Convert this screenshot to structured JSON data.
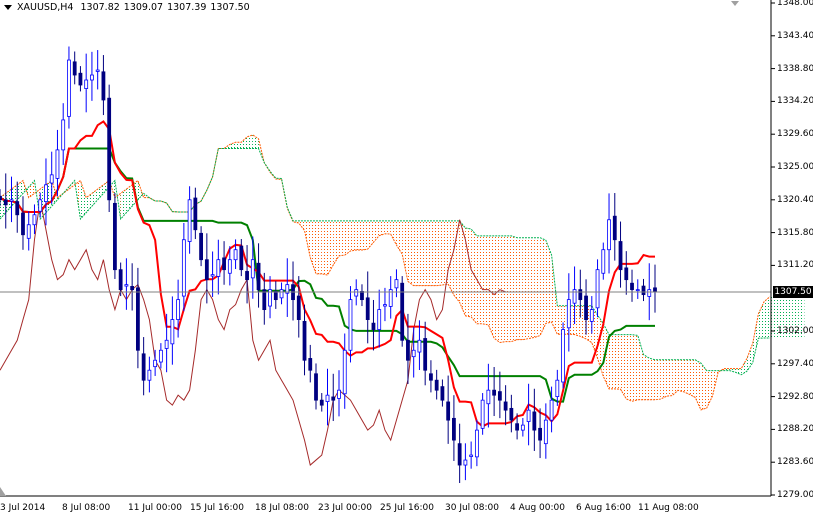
{
  "header": {
    "symbol": "XAUUSD,H4",
    "open": "1307.82",
    "high": "1309.07",
    "low": "1307.39",
    "close": "1307.50"
  },
  "colors": {
    "tenkan": "#ff0000",
    "kijun": "#008000",
    "chikou": "#a52a2a",
    "bull_candle": "#0000ff",
    "bear_candle": "#000080",
    "cloud_bull": "#00b050",
    "cloud_bear": "#ff5a00"
  },
  "chart_data": {
    "type": "candlestick",
    "title": "XAUUSD,H4",
    "indicator": "Ichimoku (9, 26, 52)",
    "ylim": [
      1279.0,
      1348.0
    ],
    "y_ticks": [
      "1348.00",
      "1343.40",
      "1338.80",
      "1334.20",
      "1329.60",
      "1325.00",
      "1320.40",
      "1315.80",
      "1311.20",
      "1302.00",
      "1297.40",
      "1292.80",
      "1288.20",
      "1283.60",
      "1279.00"
    ],
    "x_ticks": [
      "3 Jul 2014",
      "8 Jul 08:00",
      "11 Jul 00:00",
      "15 Jul 16:00",
      "18 Jul 08:00",
      "23 Jul 00:00",
      "25 Jul 16:00",
      "30 Jul 08:00",
      "4 Aug 00:00",
      "6 Aug 16:00",
      "11 Aug 08:00"
    ],
    "current_price": "1307.50",
    "closes": [
      1320.4,
      1319.7,
      1320.4,
      1318.3,
      1315.5,
      1316.9,
      1318.3,
      1320.4,
      1322.5,
      1323.9,
      1327.4,
      1331.6,
      1340.0,
      1337.9,
      1336.5,
      1337.2,
      1337.9,
      1338.6,
      1334.4,
      1320.4,
      1310.6,
      1307.8,
      1308.5,
      1307.8,
      1299.3,
      1295.1,
      1296.5,
      1297.9,
      1299.3,
      1300.7,
      1303.6,
      1306.4,
      1314.8,
      1320.4,
      1316.2,
      1312.0,
      1309.2,
      1309.9,
      1312.0,
      1310.6,
      1312.0,
      1313.4,
      1310.6,
      1309.2,
      1312.0,
      1307.8,
      1305.0,
      1307.8,
      1306.4,
      1307.8,
      1308.5,
      1306.4,
      1303.6,
      1297.9,
      1296.5,
      1292.3,
      1291.6,
      1293.0,
      1292.3,
      1293.7,
      1299.3,
      1306.4,
      1307.8,
      1306.4,
      1303.6,
      1302.2,
      1305.0,
      1305.7,
      1307.8,
      1309.2,
      1300.7,
      1297.9,
      1299.3,
      1300.7,
      1296.5,
      1295.1,
      1293.7,
      1292.3,
      1289.5,
      1286.7,
      1283.2,
      1283.9,
      1284.6,
      1288.1,
      1292.3,
      1293.7,
      1293.0,
      1292.3,
      1290.9,
      1289.5,
      1288.1,
      1288.8,
      1290.9,
      1288.1,
      1286.7,
      1289.5,
      1292.3,
      1295.1,
      1302.2,
      1306.4,
      1307.8,
      1306.4,
      1303.6,
      1305.0,
      1310.6,
      1313.4,
      1317.6,
      1314.8,
      1310.6,
      1309.2,
      1307.8,
      1307.8,
      1307.1,
      1307.8,
      1307.5
    ]
  }
}
